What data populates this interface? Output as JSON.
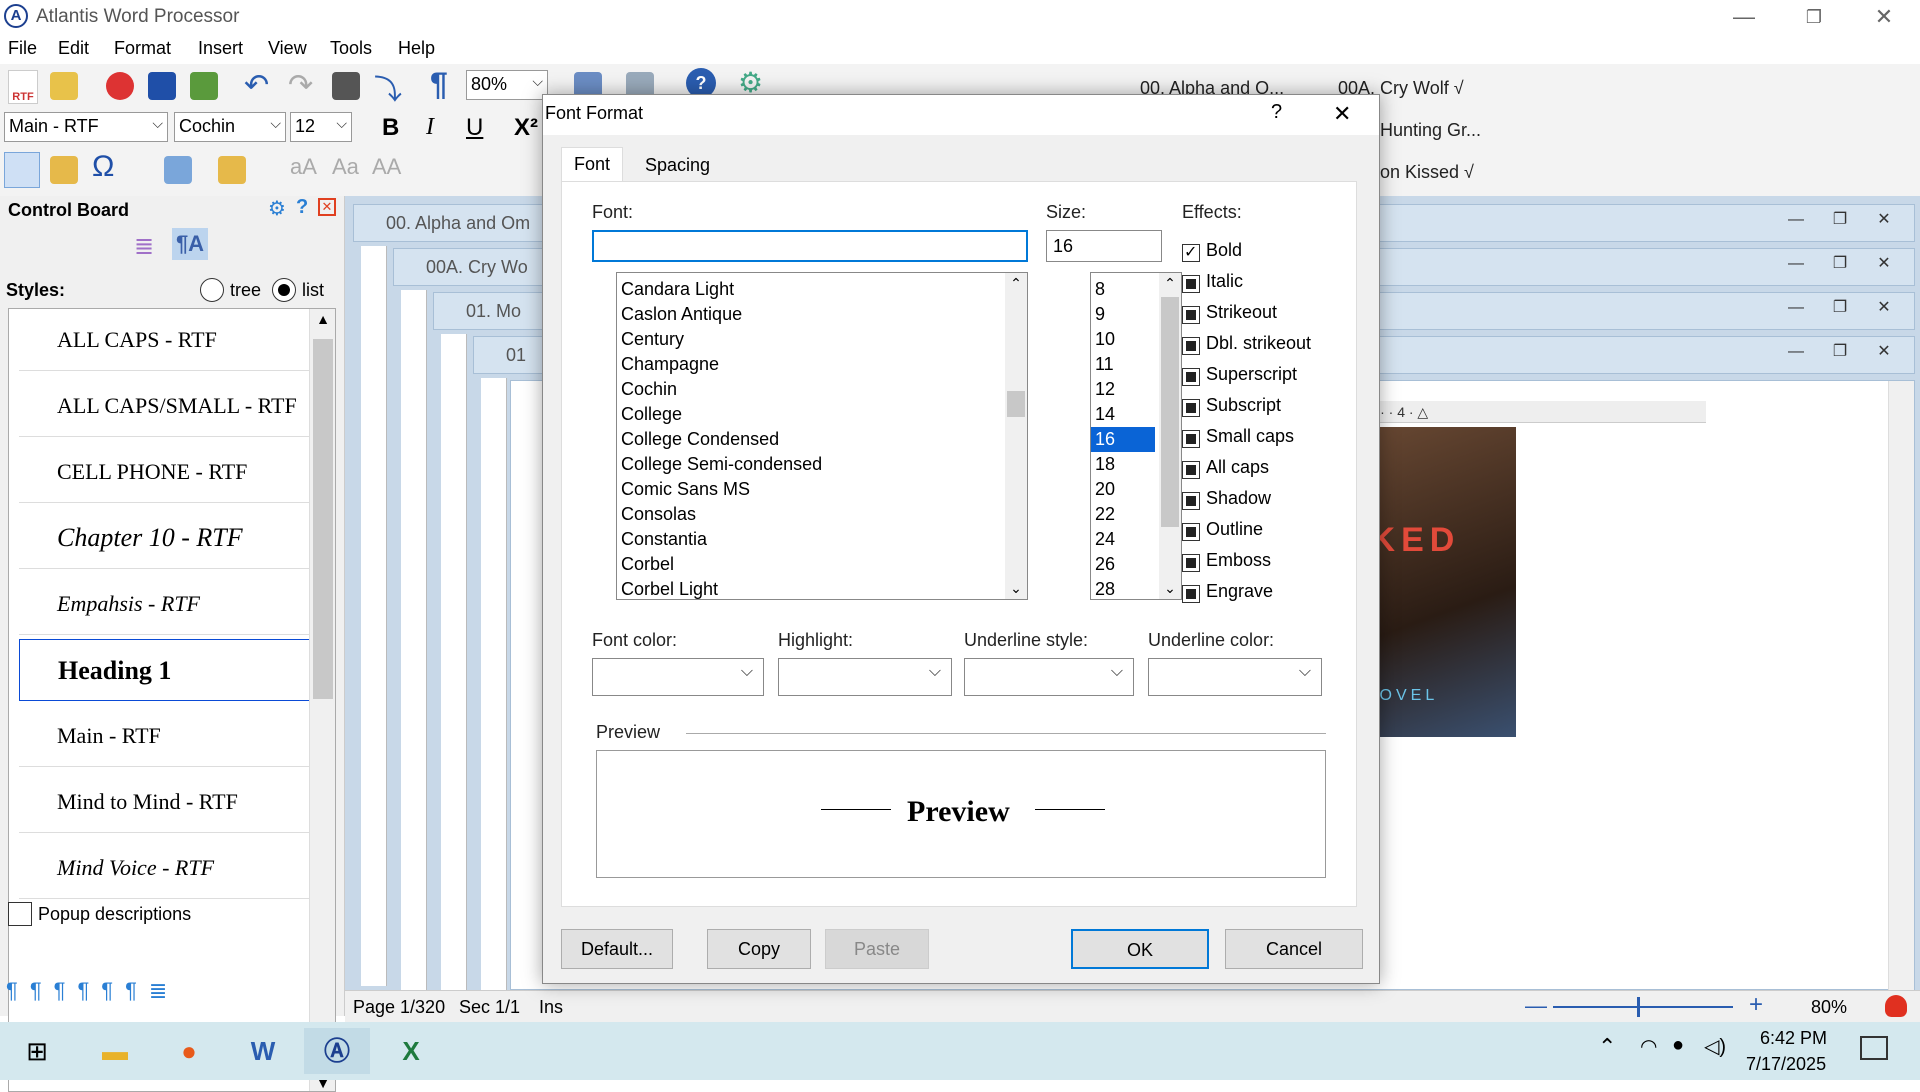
{
  "app": {
    "title": "Atlantis Word Processor",
    "logo_letter": "A"
  },
  "window_controls": {
    "minimize": "—",
    "restore": "❐",
    "close": "✕"
  },
  "menu": [
    "File",
    "Edit",
    "Format",
    "Insert",
    "View",
    "Tools",
    "Help"
  ],
  "toolbar": {
    "zoom": "80%",
    "style_combo": "Main - RTF",
    "font_combo": "Cochin",
    "size_combo": "12",
    "bold": "B",
    "italic": "I",
    "underline": "U",
    "superscript": "X²",
    "rtf_label": "RTF"
  },
  "doc_tabs": [
    "00. Alpha and O...",
    "00A. Cry Wolf √",
    "Hunting Gr...",
    "on Kissed √"
  ],
  "control_board": {
    "title": "Control Board",
    "styles_label": "Styles:",
    "view_tree": "tree",
    "view_list": "list",
    "styles": [
      {
        "label": "ALL CAPS - RTF"
      },
      {
        "label": "ALL CAPS/SMALL - RTF"
      },
      {
        "label": "CELL PHONE - RTF"
      },
      {
        "label": "Chapter 10 - RTF"
      },
      {
        "label": "Empahsis - RTF"
      },
      {
        "label": "Heading 1"
      },
      {
        "label": "Main - RTF"
      },
      {
        "label": "Mind to Mind - RTF"
      },
      {
        "label": "Mind Voice - RTF"
      }
    ],
    "popup_descriptions": "Popup descriptions"
  },
  "mdi_windows": [
    "00. Alpha and Om",
    "00A. Cry Wo",
    "01. Mo",
    "01"
  ],
  "book_cover": {
    "title_fragment": "RKED",
    "subtitle_fragment": "N NOVEL"
  },
  "statusbar": {
    "page": "Page 1/320",
    "section": "Sec 1/1",
    "mode": "Ins",
    "zoom": "80%"
  },
  "taskbar": {
    "time": "6:42 PM",
    "date": "7/17/2025"
  },
  "dialog": {
    "title": "Font Format",
    "help": "?",
    "close": "✕",
    "tabs": [
      "Font",
      "Spacing"
    ],
    "font_label": "Font:",
    "font_value": "",
    "size_label": "Size:",
    "size_value": "16",
    "effects_label": "Effects:",
    "fonts": [
      "Candara Light",
      "Caslon Antique",
      "Century",
      "Champagne",
      "Cochin",
      "College",
      "College Condensed",
      "College Semi-condensed",
      "Comic Sans MS",
      "Consolas",
      "Constantia",
      "Corbel",
      "Corbel Light"
    ],
    "sizes": [
      "8",
      "9",
      "10",
      "11",
      "12",
      "14",
      "16",
      "18",
      "20",
      "22",
      "24",
      "26",
      "28"
    ],
    "selected_size": "16",
    "effects": [
      {
        "label": "Bold",
        "state": "checked"
      },
      {
        "label": "Italic",
        "state": "indeterminate"
      },
      {
        "label": "Strikeout",
        "state": "indeterminate"
      },
      {
        "label": "Dbl. strikeout",
        "state": "indeterminate"
      },
      {
        "label": "Superscript",
        "state": "indeterminate"
      },
      {
        "label": "Subscript",
        "state": "indeterminate"
      },
      {
        "label": "Small caps",
        "state": "indeterminate"
      },
      {
        "label": "All caps",
        "state": "indeterminate"
      },
      {
        "label": "Shadow",
        "state": "indeterminate"
      },
      {
        "label": "Outline",
        "state": "indeterminate"
      },
      {
        "label": "Emboss",
        "state": "indeterminate"
      },
      {
        "label": "Engrave",
        "state": "indeterminate"
      }
    ],
    "font_color_label": "Font color:",
    "highlight_label": "Highlight:",
    "underline_style_label": "Underline style:",
    "underline_color_label": "Underline color:",
    "preview_label": "Preview",
    "preview_text": "Preview",
    "buttons": {
      "default": "Default...",
      "copy": "Copy",
      "paste": "Paste",
      "ok": "OK",
      "cancel": "Cancel"
    }
  },
  "colors": {
    "accent": "#0078d7",
    "selection": "#0a64d6",
    "mdi_bg": "#c8d8e8"
  }
}
